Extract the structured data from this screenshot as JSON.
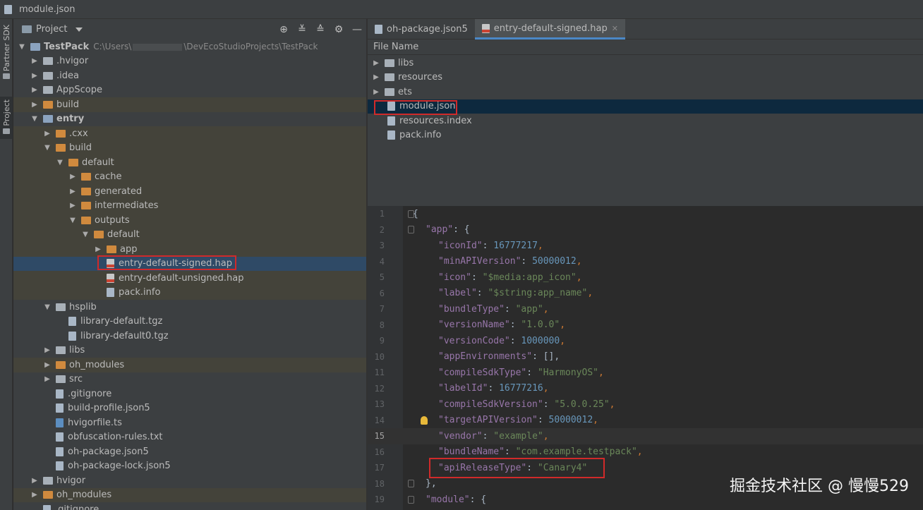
{
  "window": {
    "title": "module.json"
  },
  "sidebar": {
    "partner_sdk": "Partner SDK",
    "project": "Project"
  },
  "project_panel": {
    "view_label": "Project",
    "tree": [
      {
        "name": "TestPack",
        "path_prefix": "C:\\Users\\",
        "path_suffix": "\\DevEcoStudioProjects\\TestPack"
      },
      {
        "name": ".hvigor"
      },
      {
        "name": ".idea"
      },
      {
        "name": "AppScope"
      },
      {
        "name": "build"
      },
      {
        "name": "entry"
      },
      {
        "name": ".cxx"
      },
      {
        "name": "build"
      },
      {
        "name": "default"
      },
      {
        "name": "cache"
      },
      {
        "name": "generated"
      },
      {
        "name": "intermediates"
      },
      {
        "name": "outputs"
      },
      {
        "name": "default"
      },
      {
        "name": "app"
      },
      {
        "name": "entry-default-signed.hap"
      },
      {
        "name": "entry-default-unsigned.hap"
      },
      {
        "name": "pack.info"
      },
      {
        "name": "hsplib"
      },
      {
        "name": "library-default.tgz"
      },
      {
        "name": "library-default0.tgz"
      },
      {
        "name": "libs"
      },
      {
        "name": "oh_modules"
      },
      {
        "name": "src"
      },
      {
        "name": ".gitignore"
      },
      {
        "name": "build-profile.json5"
      },
      {
        "name": "hvigorfile.ts"
      },
      {
        "name": "obfuscation-rules.txt"
      },
      {
        "name": "oh-package.json5"
      },
      {
        "name": "oh-package-lock.json5"
      },
      {
        "name": "hvigor"
      },
      {
        "name": "oh_modules"
      },
      {
        "name": ".gitignore"
      }
    ]
  },
  "editor": {
    "tabs": [
      {
        "label": "oh-package.json5"
      },
      {
        "label": "entry-default-signed.hap"
      }
    ],
    "hap_view": {
      "header": "File Name",
      "items": [
        {
          "name": "libs"
        },
        {
          "name": "resources"
        },
        {
          "name": "ets"
        },
        {
          "name": "module.json"
        },
        {
          "name": "resources.index"
        },
        {
          "name": "pack.info"
        }
      ]
    },
    "code": {
      "line_numbers": [
        "1",
        "2",
        "3",
        "4",
        "5",
        "6",
        "7",
        "8",
        "9",
        "10",
        "11",
        "12",
        "13",
        "14",
        "15",
        "16",
        "17",
        "18",
        "19"
      ],
      "current_line": "15",
      "lines": [
        [
          {
            "t": "{",
            "c": "w"
          }
        ],
        [
          {
            "t": "\"app\"",
            "c": "k"
          },
          {
            "t": ": {",
            "c": "w"
          }
        ],
        [
          {
            "t": "\"iconId\"",
            "c": "k"
          },
          {
            "t": ": ",
            "c": "w"
          },
          {
            "t": "16777217",
            "c": "n"
          },
          {
            "t": ",",
            "c": "p"
          }
        ],
        [
          {
            "t": "\"minAPIVersion\"",
            "c": "k"
          },
          {
            "t": ": ",
            "c": "w"
          },
          {
            "t": "50000012",
            "c": "n"
          },
          {
            "t": ",",
            "c": "p"
          }
        ],
        [
          {
            "t": "\"icon\"",
            "c": "k"
          },
          {
            "t": ": ",
            "c": "w"
          },
          {
            "t": "\"$media:app_icon\"",
            "c": "s"
          },
          {
            "t": ",",
            "c": "p"
          }
        ],
        [
          {
            "t": "\"label\"",
            "c": "k"
          },
          {
            "t": ": ",
            "c": "w"
          },
          {
            "t": "\"$string:app_name\"",
            "c": "s"
          },
          {
            "t": ",",
            "c": "p"
          }
        ],
        [
          {
            "t": "\"bundleType\"",
            "c": "k"
          },
          {
            "t": ": ",
            "c": "w"
          },
          {
            "t": "\"app\"",
            "c": "s"
          },
          {
            "t": ",",
            "c": "p"
          }
        ],
        [
          {
            "t": "\"versionName\"",
            "c": "k"
          },
          {
            "t": ": ",
            "c": "w"
          },
          {
            "t": "\"1.0.0\"",
            "c": "s"
          },
          {
            "t": ",",
            "c": "p"
          }
        ],
        [
          {
            "t": "\"versionCode\"",
            "c": "k"
          },
          {
            "t": ": ",
            "c": "w"
          },
          {
            "t": "1000000",
            "c": "n"
          },
          {
            "t": ",",
            "c": "p"
          }
        ],
        [
          {
            "t": "\"appEnvironments\"",
            "c": "k"
          },
          {
            "t": ": [],",
            "c": "w"
          }
        ],
        [
          {
            "t": "\"compileSdkType\"",
            "c": "k"
          },
          {
            "t": ": ",
            "c": "w"
          },
          {
            "t": "\"HarmonyOS\"",
            "c": "s"
          },
          {
            "t": ",",
            "c": "p"
          }
        ],
        [
          {
            "t": "\"labelId\"",
            "c": "k"
          },
          {
            "t": ": ",
            "c": "w"
          },
          {
            "t": "16777216",
            "c": "n"
          },
          {
            "t": ",",
            "c": "p"
          }
        ],
        [
          {
            "t": "\"compileSdkVersion\"",
            "c": "k"
          },
          {
            "t": ": ",
            "c": "w"
          },
          {
            "t": "\"5.0.0.25\"",
            "c": "s"
          },
          {
            "t": ",",
            "c": "p"
          }
        ],
        [
          {
            "t": "\"targetAPIVersion\"",
            "c": "k"
          },
          {
            "t": ": ",
            "c": "w"
          },
          {
            "t": "50000012",
            "c": "n"
          },
          {
            "t": ",",
            "c": "p"
          }
        ],
        [
          {
            "t": "\"vendor\"",
            "c": "k"
          },
          {
            "t": ": ",
            "c": "w"
          },
          {
            "t": "\"example\"",
            "c": "s"
          },
          {
            "t": ",",
            "c": "p"
          }
        ],
        [
          {
            "t": "\"bundleName\"",
            "c": "k"
          },
          {
            "t": ": ",
            "c": "w"
          },
          {
            "t": "\"com.example.testpack\"",
            "c": "s"
          },
          {
            "t": ",",
            "c": "p"
          }
        ],
        [
          {
            "t": "\"apiReleaseType\"",
            "c": "k"
          },
          {
            "t": ": ",
            "c": "w"
          },
          {
            "t": "\"Canary4\"",
            "c": "s"
          }
        ],
        [
          {
            "t": "},",
            "c": "w"
          }
        ],
        [
          {
            "t": "\"module\"",
            "c": "k"
          },
          {
            "t": ": {",
            "c": "w"
          }
        ]
      ]
    }
  },
  "watermark": "掘金技术社区 @ 慢慢529"
}
